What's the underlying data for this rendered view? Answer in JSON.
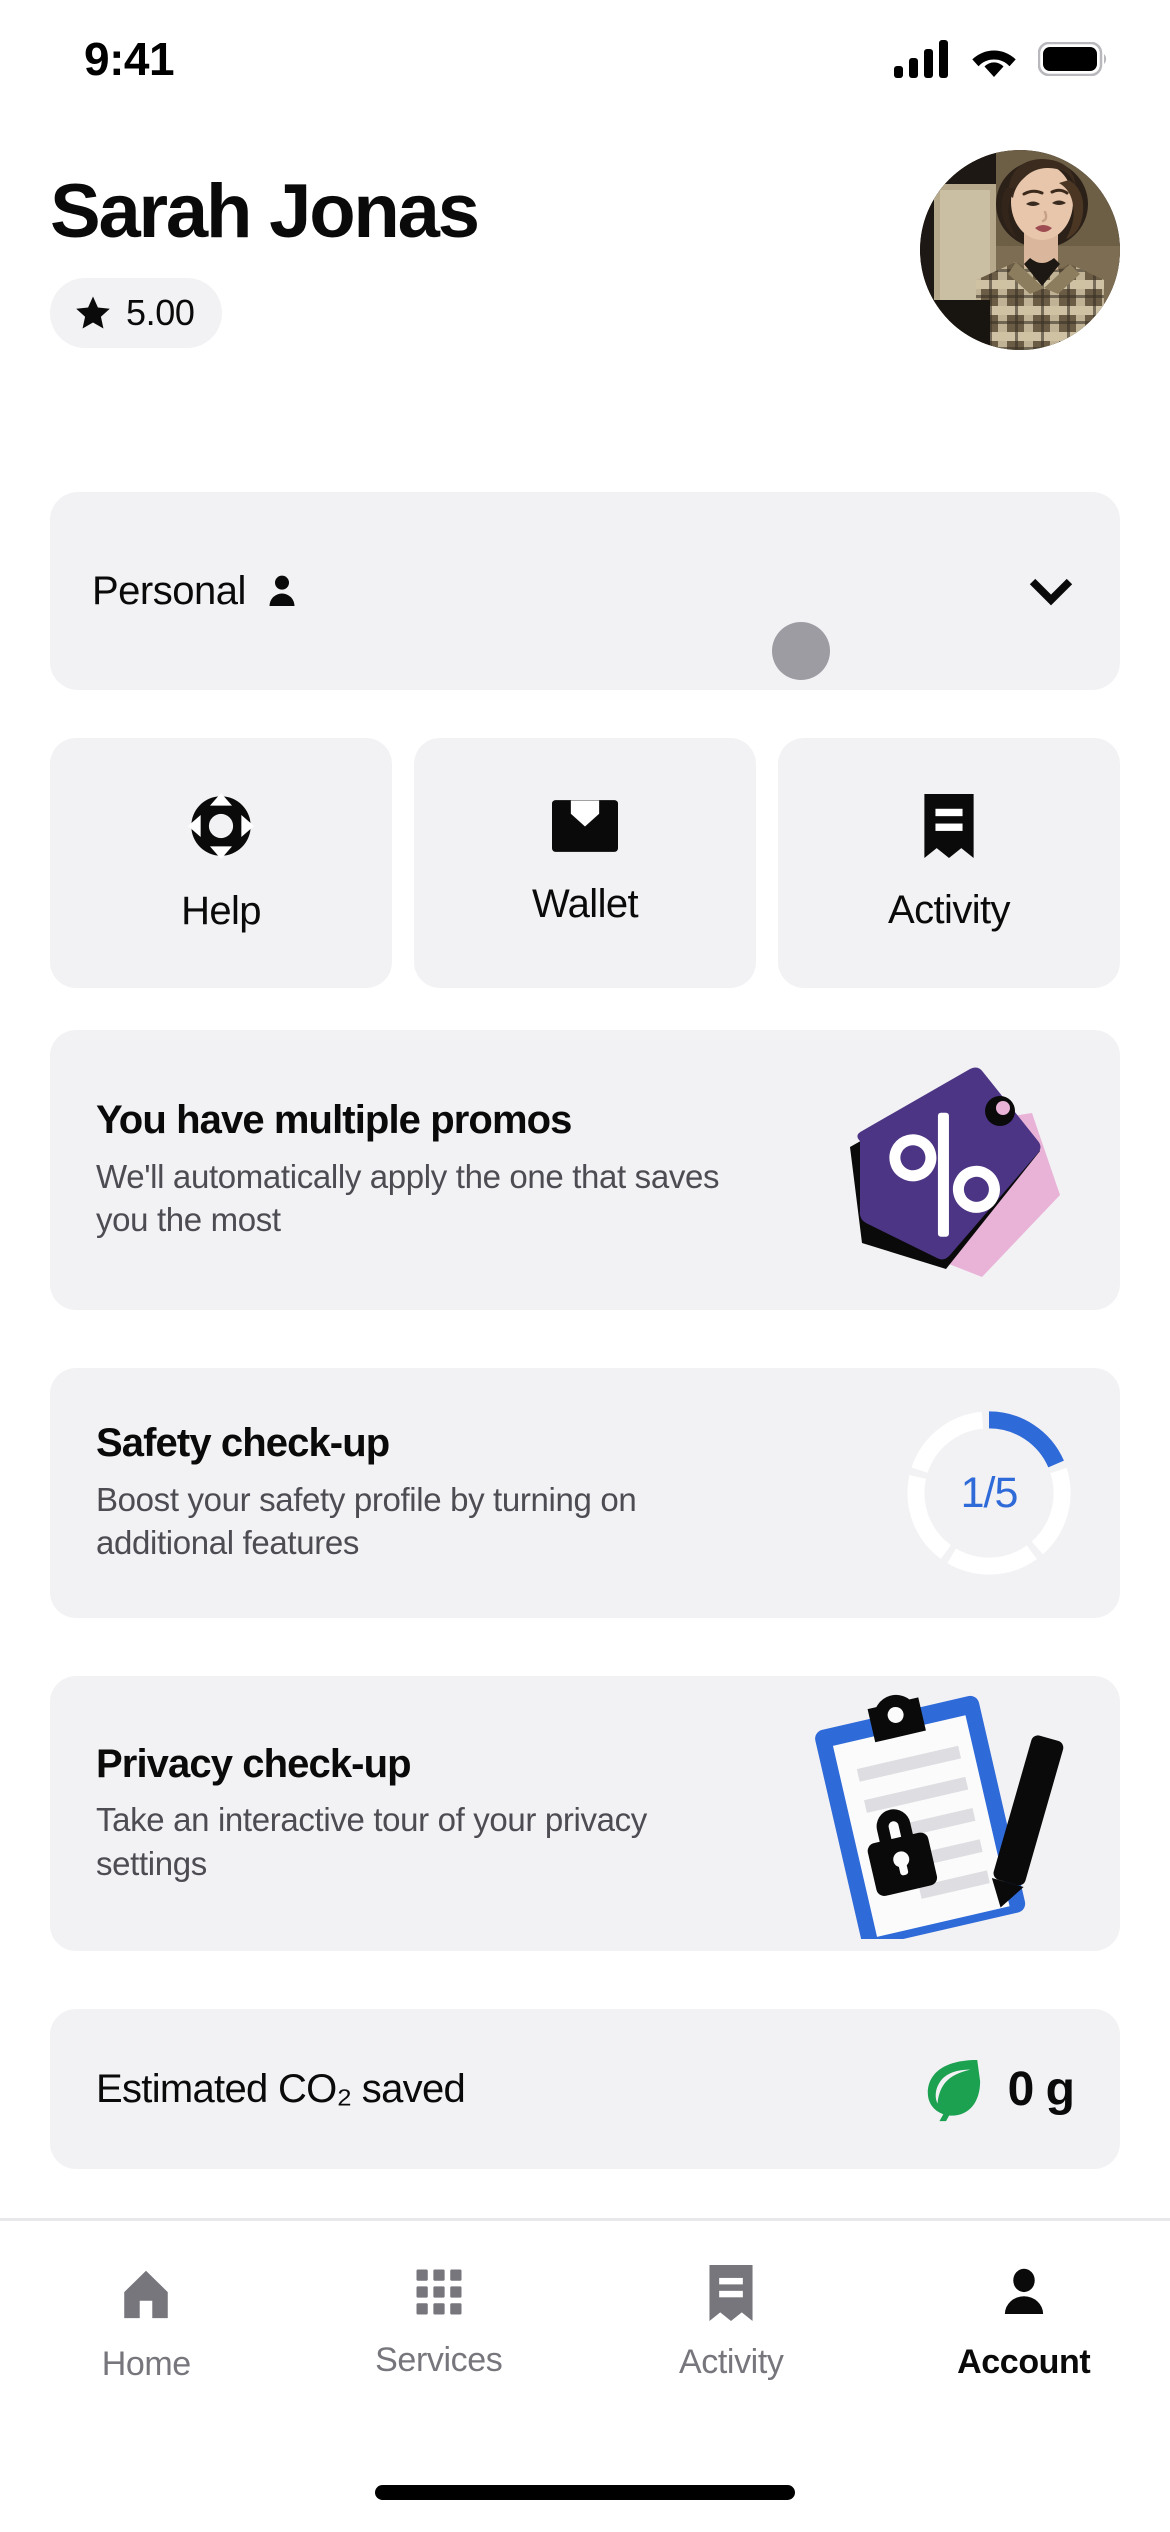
{
  "status_bar": {
    "time": "9:41",
    "cellular_icon": "cellular-signal-icon",
    "wifi_icon": "wifi-icon",
    "battery_icon": "battery-full-icon"
  },
  "header": {
    "user_name": "Sarah Jonas",
    "rating": "5.00",
    "rating_icon": "star-icon",
    "avatar_alt": "user-profile-photo"
  },
  "account_switch": {
    "label": "Personal",
    "person_icon": "person-icon",
    "chevron_icon": "chevron-down-icon"
  },
  "quick_actions": [
    {
      "label": "Help",
      "icon": "lifebuoy-icon"
    },
    {
      "label": "Wallet",
      "icon": "wallet-icon"
    },
    {
      "label": "Activity",
      "icon": "receipt-icon"
    }
  ],
  "cards": {
    "promos": {
      "title": "You have multiple promos",
      "subtitle": "We'll automatically apply the one that saves you the most",
      "art": "promo-tag-illustration",
      "colors": {
        "tag_purple": "#4c3584",
        "tag_pink": "#e9b3d8"
      }
    },
    "safety": {
      "title": "Safety check-up",
      "subtitle": "Boost your safety profile by turning on additional features",
      "progress_text": "1/5",
      "progress_completed": 1,
      "progress_total": 5,
      "art": "segmented-progress-ring",
      "colors": {
        "active": "#2f6ad9",
        "inactive": "#ffffff"
      }
    },
    "privacy": {
      "title": "Privacy check-up",
      "subtitle": "Take an interactive tour of your privacy settings",
      "art": "clipboard-lock-illustration",
      "colors": {
        "clipboard_blue": "#2f6ad9"
      }
    },
    "co2": {
      "label": "Estimated CO₂ saved",
      "value": "0 g",
      "icon": "leaf-icon",
      "colors": {
        "leaf_green": "#1ba150"
      }
    }
  },
  "tab_bar": {
    "items": [
      {
        "label": "Home",
        "icon": "home-icon",
        "active": false
      },
      {
        "label": "Services",
        "icon": "grid-icon",
        "active": false
      },
      {
        "label": "Activity",
        "icon": "receipt-icon",
        "active": false
      },
      {
        "label": "Account",
        "icon": "person-icon",
        "active": true
      }
    ]
  },
  "theme": {
    "page_background": "#ffffff",
    "card_background": "#f2f1f4",
    "text_primary": "#0a0a0a",
    "text_secondary": "#4c4c52",
    "text_muted": "#77767c",
    "accent_blue": "#2f6ad9",
    "cursor_color": "#9c9ca2"
  }
}
